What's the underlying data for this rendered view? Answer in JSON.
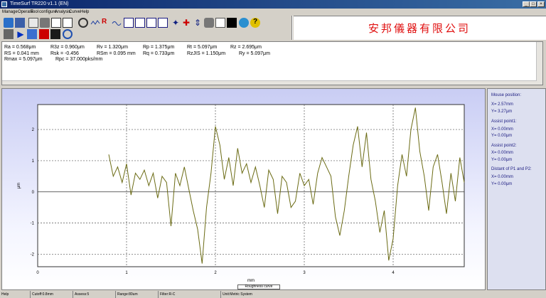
{
  "window": {
    "title": "TimeSurf TR220 v1.1 (EN)"
  },
  "menu": [
    "Manage",
    "Operate",
    "Tool",
    "configure",
    "Analysis",
    "Curve",
    "Help"
  ],
  "company": {
    "name": "安邦儀器有限公司"
  },
  "params": {
    "row1": [
      "Ra    =  0.568μm",
      "R3z   =  0.960μm",
      "Rv   =  1.320μm",
      "Rp    =  1.375μm",
      "Rt    =  5.097μm",
      "Rz    =  2.695μm"
    ],
    "row2": [
      "RS    =  0.041 mm",
      "Rsk   =  -0.456",
      "RSm  =  0.095 mm",
      "Rq    =  0.733μm",
      "RzJIS =  1.150μm",
      "Ry    =  5.097μm"
    ],
    "row3": [
      "Rmax  =  5.097μm",
      "Rpc   =  37.000pks/mm"
    ]
  },
  "side": {
    "mouse_title": "Mouse position:",
    "mouse_x": "X=   2.57mm",
    "mouse_y": "Y=   3.27μm",
    "a1_title": "Assist point1:",
    "a1_x": "X=    0.00mm",
    "a1_y": "Y=    0.00μm",
    "a2_title": "Assist point2:",
    "a2_x": "X=    0.00mm",
    "a2_y": "Y=    0.00μm",
    "dist_title": "Distant of P1 and P2:",
    "dist_x": "X=    0.00mm",
    "dist_y": "Y=    0.00μm"
  },
  "chart_data": {
    "type": "line",
    "xlabel": "mm",
    "ylabel": "μm",
    "xlim": [
      0,
      4.8
    ],
    "ylim": [
      -2.4,
      2.8
    ],
    "xticks": [
      0,
      1,
      2,
      3,
      4
    ],
    "yticks": [
      -2,
      -1,
      0,
      1,
      2
    ],
    "series": [
      {
        "name": "Roughness curve",
        "color": "#6b6b14",
        "x": [
          0.8,
          0.85,
          0.9,
          0.95,
          1.0,
          1.05,
          1.1,
          1.15,
          1.2,
          1.25,
          1.3,
          1.35,
          1.4,
          1.45,
          1.5,
          1.55,
          1.6,
          1.65,
          1.7,
          1.75,
          1.8,
          1.85,
          1.9,
          1.95,
          2.0,
          2.05,
          2.1,
          2.15,
          2.2,
          2.25,
          2.3,
          2.35,
          2.4,
          2.45,
          2.5,
          2.55,
          2.6,
          2.65,
          2.7,
          2.75,
          2.8,
          2.85,
          2.9,
          2.95,
          3.0,
          3.05,
          3.1,
          3.15,
          3.2,
          3.25,
          3.3,
          3.35,
          3.4,
          3.45,
          3.5,
          3.55,
          3.6,
          3.65,
          3.7,
          3.75,
          3.8,
          3.85,
          3.9,
          3.95,
          4.0,
          4.05,
          4.1,
          4.15,
          4.2,
          4.25,
          4.3,
          4.35,
          4.4,
          4.45,
          4.5,
          4.55,
          4.6,
          4.65,
          4.7,
          4.75,
          4.8
        ],
        "values": [
          1.2,
          0.5,
          0.8,
          0.3,
          0.9,
          -0.1,
          0.6,
          0.4,
          0.7,
          0.2,
          0.6,
          -0.2,
          0.5,
          0.3,
          -1.1,
          0.6,
          0.2,
          0.8,
          0.1,
          -0.6,
          -1.2,
          -2.3,
          -0.5,
          0.6,
          2.1,
          1.5,
          0.4,
          1.1,
          0.2,
          1.4,
          0.6,
          0.9,
          0.3,
          0.8,
          0.2,
          -0.5,
          0.7,
          0.4,
          -0.7,
          0.5,
          0.3,
          -0.5,
          -0.3,
          0.6,
          0.2,
          0.4,
          -0.4,
          0.6,
          1.1,
          0.8,
          0.5,
          -0.8,
          -1.4,
          -0.6,
          0.5,
          1.5,
          2.1,
          0.8,
          1.9,
          0.4,
          -0.3,
          -1.3,
          -0.6,
          -2.2,
          -1.5,
          0.2,
          1.2,
          0.5,
          2.0,
          2.7,
          1.3,
          0.5,
          -0.6,
          0.8,
          1.2,
          0.3,
          -0.7,
          0.6,
          -0.3,
          1.1,
          0.3
        ]
      }
    ],
    "grid": true
  },
  "legend": {
    "label": "Roughness curve"
  },
  "status": [
    "Help",
    "Cutoff:0.8mm",
    "Assess:5",
    "Range:80um",
    "Filter:R-C",
    "Unit:Metric System"
  ]
}
